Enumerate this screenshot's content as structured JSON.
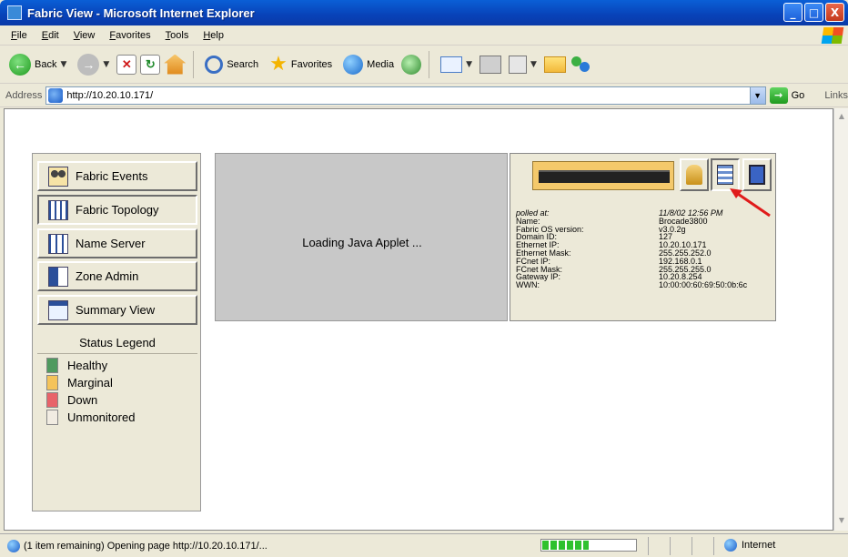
{
  "window": {
    "title": "Fabric View - Microsoft Internet Explorer",
    "minimize": "_",
    "maximize": "□",
    "close": "X"
  },
  "menu": [
    "File",
    "Edit",
    "View",
    "Favorites",
    "Tools",
    "Help"
  ],
  "toolbar": {
    "back_label": "Back",
    "search_label": "Search",
    "favorites_label": "Favorites",
    "media_label": "Media"
  },
  "address": {
    "label": "Address",
    "url": "http://10.20.10.171/",
    "go_label": "Go",
    "links_label": "Links"
  },
  "nav": [
    {
      "label": "Fabric Events",
      "icon": "fabric-events-icon"
    },
    {
      "label": "Fabric Topology",
      "icon": "fabric-topology-icon"
    },
    {
      "label": "Name Server",
      "icon": "name-server-icon"
    },
    {
      "label": "Zone Admin",
      "icon": "zone-admin-icon"
    },
    {
      "label": "Summary View",
      "icon": "summary-view-icon"
    }
  ],
  "legend": {
    "title": "Status Legend",
    "items": [
      {
        "label": "Healthy",
        "color": "#4f9a5f"
      },
      {
        "label": "Marginal",
        "color": "#f4c35a"
      },
      {
        "label": "Down",
        "color": "#e8636a"
      },
      {
        "label": "Unmonitored",
        "color": "#f1ece2"
      }
    ]
  },
  "applet": {
    "text": "Loading Java Applet ..."
  },
  "switch_info": {
    "polled_label": "polled at:",
    "polled_value": "11/8/02 12:56 PM",
    "rows": [
      {
        "label": "Name:",
        "value": "Brocade3800"
      },
      {
        "label": "Fabric OS version:",
        "value": "v3.0.2g"
      },
      {
        "label": "Domain ID:",
        "value": "127"
      },
      {
        "label": "Ethernet IP:",
        "value": "10.20.10.171"
      },
      {
        "label": "Ethernet Mask:",
        "value": "255.255.252.0"
      },
      {
        "label": "FCnet IP:",
        "value": "192.168.0.1"
      },
      {
        "label": "FCnet Mask:",
        "value": "255.255.255.0"
      },
      {
        "label": "Gateway IP:",
        "value": "10.20.8.254"
      },
      {
        "label": "WWN:",
        "value": "10:00:00:60:69:50:0b:6c"
      }
    ]
  },
  "status": {
    "text": "(1 item remaining) Opening page http://10.20.10.171/...",
    "progress": 0.5,
    "zone": "Internet"
  }
}
